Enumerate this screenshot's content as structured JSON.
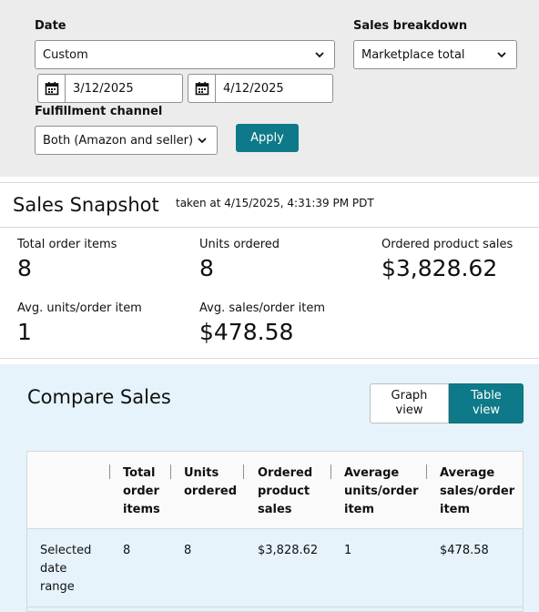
{
  "filters": {
    "date_label": "Date",
    "date_select": "Custom",
    "start_date": "3/12/2025",
    "end_date": "4/12/2025",
    "fulfillment_label": "Fulfillment channel",
    "fulfillment_select": "Both (Amazon and seller)",
    "apply_label": "Apply",
    "breakdown_label": "Sales breakdown",
    "breakdown_select": "Marketplace total"
  },
  "snapshot": {
    "title": "Sales Snapshot",
    "taken_at": "taken at 4/15/2025, 4:31:39 PM PDT",
    "metrics": [
      {
        "label": "Total order items",
        "value": "8"
      },
      {
        "label": "Units ordered",
        "value": "8"
      },
      {
        "label": "Ordered product sales",
        "value": "$3,828.62"
      },
      {
        "label": "Avg. units/order item",
        "value": "1"
      },
      {
        "label": "Avg. sales/order item",
        "value": "$478.58"
      }
    ]
  },
  "compare": {
    "title": "Compare Sales",
    "graph_view": "Graph view",
    "table_view": "Table view",
    "headers": {
      "total_order_items": "Total order items",
      "units_ordered": "Units ordered",
      "ordered_product_sales": "Ordered product sales",
      "avg_units": "Average units/order item",
      "avg_sales": "Average sales/order item"
    },
    "rows": [
      {
        "label": "Selected date range",
        "total_order_items": "8",
        "units_ordered": "8",
        "ordered_product_sales": "$3,828.62",
        "avg_units": "1",
        "avg_sales": "$478.58"
      }
    ]
  },
  "colors": {
    "accent": "#0e7a89",
    "filter_bg": "#ececec",
    "compare_bg": "#e6f3fa"
  },
  "icons": [
    "calendar-icon",
    "chevron-down-icon"
  ]
}
